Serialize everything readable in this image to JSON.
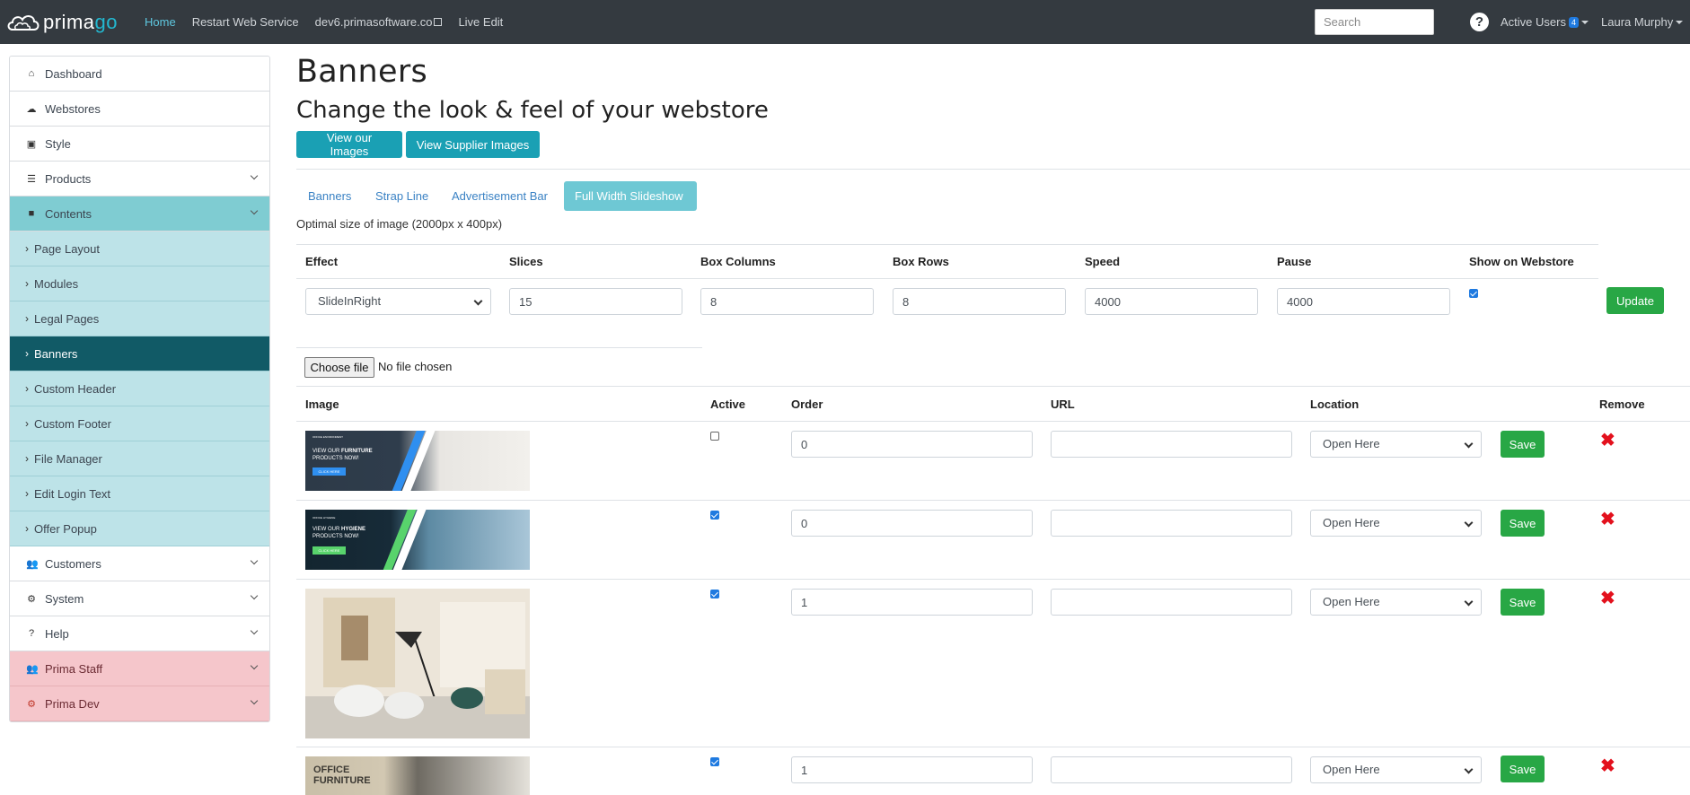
{
  "navbar": {
    "brand_prefix": "prima",
    "brand_suffix": "go",
    "links": [
      "Home",
      "Restart Web Service",
      "dev6.primasoftware.co",
      "Live Edit"
    ],
    "search_placeholder": "Search",
    "help": "?",
    "active_users_label": "Active Users",
    "active_users_count": "4",
    "user_name": "Laura Murphy"
  },
  "sidebar": {
    "items": [
      {
        "label": "Dashboard",
        "icon": "home-icon"
      },
      {
        "label": "Webstores",
        "icon": "cloud-icon"
      },
      {
        "label": "Style",
        "icon": "image-icon"
      },
      {
        "label": "Products",
        "icon": "list-icon"
      },
      {
        "label": "Contents",
        "icon": "folder-icon"
      },
      {
        "label": "Page Layout"
      },
      {
        "label": "Modules"
      },
      {
        "label": "Legal Pages"
      },
      {
        "label": "Banners"
      },
      {
        "label": "Custom Header"
      },
      {
        "label": "Custom Footer"
      },
      {
        "label": "File Manager"
      },
      {
        "label": "Edit Login Text"
      },
      {
        "label": "Offer Popup"
      },
      {
        "label": "Customers",
        "icon": "users-icon"
      },
      {
        "label": "System",
        "icon": "gear-icon"
      },
      {
        "label": "Help",
        "icon": "question-icon"
      },
      {
        "label": "Prima Staff",
        "icon": "users-icon"
      },
      {
        "label": "Prima Dev",
        "icon": "gear-icon"
      }
    ]
  },
  "page": {
    "title": "Banners",
    "subtitle": "Change the look & feel of your webstore",
    "btn_our_images": "View our Images",
    "btn_supplier_images": "View Supplier Images",
    "tabs": [
      "Banners",
      "Strap Line",
      "Advertisement Bar",
      "Full Width Slideshow"
    ],
    "optimal_size": "Optimal size of image (2000px x 400px)"
  },
  "settings": {
    "headers": [
      "Effect",
      "Slices",
      "Box Columns",
      "Box Rows",
      "Speed",
      "Pause",
      "Show on Webstore"
    ],
    "effect": "SlideInRight",
    "slices": "15",
    "box_columns": "8",
    "box_rows": "8",
    "speed": "4000",
    "pause": "4000",
    "show_on_webstore": true,
    "update_label": "Update"
  },
  "upload": {
    "choose_label": "Choose file",
    "no_file": "No file chosen"
  },
  "table": {
    "headers": [
      "Image",
      "Active",
      "Order",
      "URL",
      "Location",
      "Remove"
    ],
    "save_label": "Save",
    "rows": [
      {
        "active": false,
        "order": "0",
        "url": "",
        "location": "Open Here"
      },
      {
        "active": true,
        "order": "0",
        "url": "",
        "location": "Open Here"
      },
      {
        "active": true,
        "order": "1",
        "url": "",
        "location": "Open Here"
      },
      {
        "active": true,
        "order": "1",
        "url": "",
        "location": "Open Here"
      }
    ],
    "thumb1": {
      "line1": "OFFICE ENVIRONMENT",
      "line2": "VIEW OUR",
      "bold2": "FURNITURE",
      "line3": "PRODUCTS NOW!",
      "cta": "CLICK HERE"
    },
    "thumb2": {
      "line1": "OFFICE HYGIENE",
      "line2": "VIEW OUR",
      "bold2": "HYGIENE",
      "line3": "PRODUCTS NOW!",
      "cta": "CLICK HERE"
    },
    "thumb4": {
      "line1": "OFFICE",
      "line2": "FURNITURE"
    }
  },
  "colors": {
    "navbar": "#343a40",
    "teal_button": "#1aa0b4",
    "active_tab": "#6ec8d4",
    "sidebar_open": "#7fccd2",
    "sidebar_sub": "#bde3e8",
    "sidebar_current": "#115a66",
    "sidebar_pink": "#f5c6cb",
    "save_green": "#28a745",
    "remove_red": "#e3111d"
  }
}
